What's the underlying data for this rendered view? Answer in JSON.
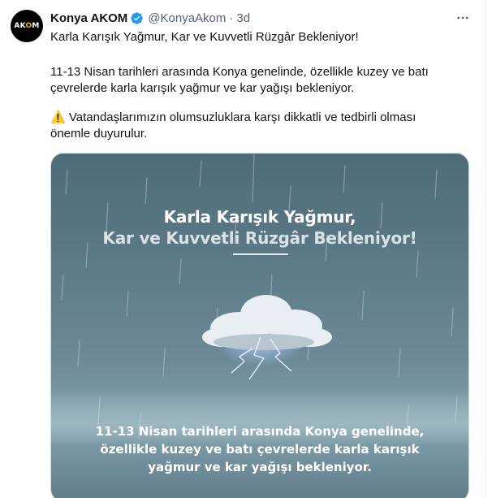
{
  "tweet": {
    "author_name": "Konya AKOM",
    "handle": "@KonyaAkom",
    "separator": "·",
    "time": "3d",
    "avatar_text": "AKOM",
    "verified_color": "#1d9bf0",
    "more_icon": "more-horizontal-icon",
    "text": {
      "line1": "Karla Karışık Yağmur, Kar ve Kuvvetli Rüzgâr Bekleniyor!",
      "line2": "11-13 Nisan tarihleri arasında Konya genelinde, özellikle kuzey ve batı",
      "line3": "çevrelerde karla karışık yağmur ve kar yağışı bekleniyor.",
      "warning_emoji": "⚠️",
      "line4": "Vatandaşlarımızın olumsuzluklara karşı dikkatli ve tedbirli olması",
      "line5": "önemle duyurulur."
    }
  },
  "media": {
    "title_line1": "Karla Karışık Yağmur,",
    "title_line2": "Kar ve Kuvvetli Rüzgâr Bekleniyor!",
    "body_line1": "11-13 Nisan tarihleri arasında Konya genelinde,",
    "body_line2": "özellikle kuzey ve batı çevrelerde karla karışık",
    "body_line3": "yağmur ve kar yağışı bekleniyor."
  },
  "colors": {
    "text": "#0f1419",
    "secondary": "#536471",
    "verified": "#1d9bf0",
    "media_sky": "#5f7c89"
  }
}
